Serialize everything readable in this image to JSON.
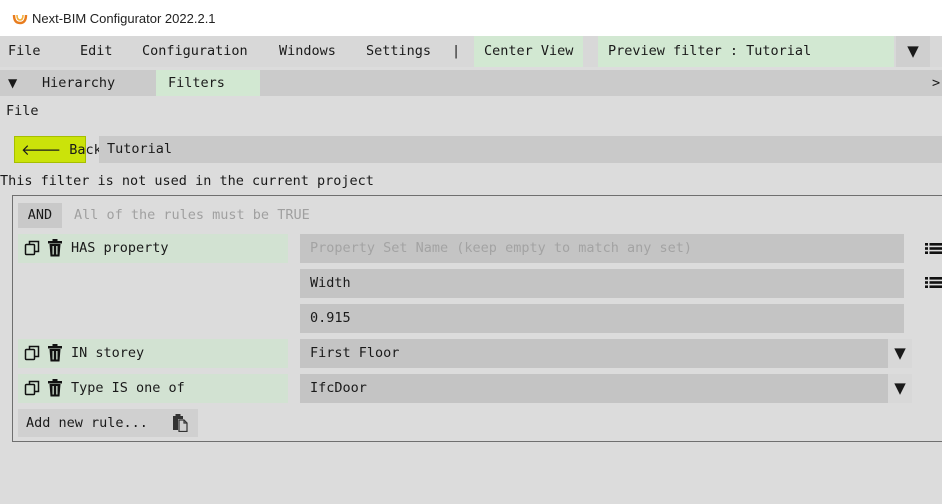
{
  "window": {
    "title": "Next-BIM Configurator 2022.2.1",
    "icon": "app-logo-icon"
  },
  "menubar": {
    "items": [
      "File",
      "Edit",
      "Configuration",
      "Windows",
      "Settings"
    ],
    "separator": "|",
    "center_view": "Center View",
    "preview_filter": "Preview filter : Tutorial",
    "dropdown_icon": "triangle-down-icon"
  },
  "tabs": {
    "collapse_icon": "collapse-triangle-icon",
    "items": [
      "Hierarchy",
      "Filters"
    ],
    "active": "Filters",
    "overflow": ">"
  },
  "file_label": "File",
  "back": {
    "label": "Back",
    "icon": "arrow-left-icon"
  },
  "filter_name": "Tutorial",
  "notice": "This filter is not used in the current project",
  "rules": {
    "operator": "AND",
    "operator_desc": "All of the rules must be TRUE",
    "items": [
      {
        "label": "HAS property",
        "property_set_placeholder": "Property Set Name (keep empty to match any set)",
        "property": "Width",
        "value": "0.915"
      },
      {
        "label": "IN storey",
        "value": "First Floor"
      },
      {
        "label": "Type IS one of",
        "value": "IfcDoor"
      }
    ],
    "add_label": "Add new rule...",
    "accent_colors": {
      "back_button": "#cbe30a",
      "selected": "#d2e8d2"
    }
  }
}
